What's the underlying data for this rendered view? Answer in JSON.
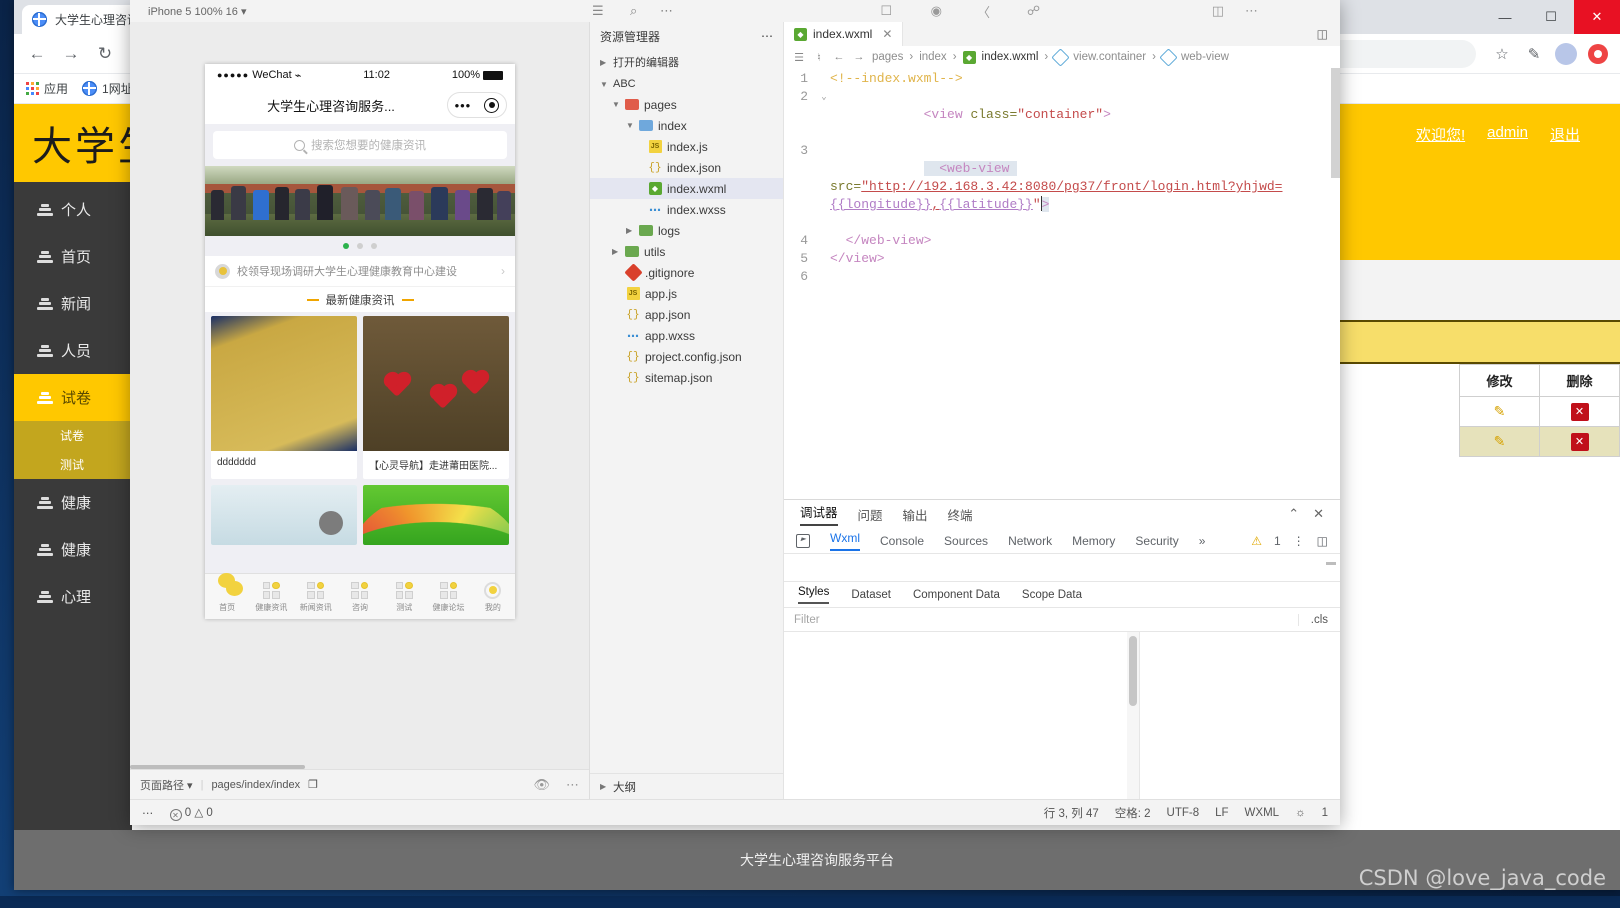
{
  "browser": {
    "tab_title": "大学生心理咨询服务平台",
    "address_value": "",
    "bookmarks": [
      {
        "label": "应用",
        "icon": "apps-grid-icon"
      },
      {
        "label": "1网址",
        "icon": "globe-icon"
      }
    ],
    "window_controls": {
      "minimize": "—",
      "maximize": "☐",
      "close": "✕"
    },
    "nav": {
      "back": "←",
      "forward": "→",
      "reload": "↻",
      "info": "ⓘ"
    },
    "toolbar_icons": [
      "star-icon",
      "extension-icon",
      "profile-avatar-icon",
      "block-icon"
    ]
  },
  "site": {
    "header_title": "大学生",
    "welcome": {
      "greeting": "欢迎您!",
      "user": "admin",
      "logout": "退出"
    },
    "menu": [
      {
        "label": "个人",
        "active": false
      },
      {
        "label": "首页",
        "active": false
      },
      {
        "label": "新闻",
        "active": false
      },
      {
        "label": "人员",
        "active": false
      },
      {
        "label": "试卷",
        "active": true
      },
      {
        "label": "健康",
        "active": false
      },
      {
        "label": "健康",
        "active": false
      },
      {
        "label": "心理",
        "active": false
      }
    ],
    "submenu": [
      {
        "label": "试卷"
      },
      {
        "label": "测试"
      }
    ],
    "table": {
      "headers": [
        "修改",
        "删除"
      ],
      "rows": [
        {
          "edit": "✎",
          "delete": "✕"
        },
        {
          "edit": "✎",
          "delete": "✕"
        }
      ]
    },
    "footer": "大学生心理咨询服务平台"
  },
  "watermark": "CSDN @love_java_code",
  "ide": {
    "top_bar": {
      "device": "iPhone 5 100% 16",
      "icons": [
        "phone-icon",
        "record-icon",
        "sound-icon",
        "share-icon"
      ]
    },
    "simulator": {
      "status": {
        "carrier_dots": "●●●●●",
        "carrier": "WeChat",
        "wifi": "⌁",
        "time": "11:02",
        "battery_pct": "100%"
      },
      "nav_title": "大学生心理咨询服务...",
      "capsule": {
        "dots": "•••",
        "circle": "target-icon"
      },
      "search_placeholder": "搜索您想要的健康资讯",
      "carousel_dots": 3,
      "carousel_active": 0,
      "notice": "校领导现场调研大学生心理健康教育中心建设",
      "section_title": "最新健康资讯",
      "cards": [
        {
          "caption": "ddddddd",
          "thumb": "poster-yellow"
        },
        {
          "caption": "【心灵导航】走进莆田医院...",
          "thumb": "hearts-wood"
        },
        {
          "caption": "",
          "thumb": "pale-blue"
        },
        {
          "caption": "",
          "thumb": "rainbow-green"
        }
      ],
      "tabbar": [
        {
          "label": "首页",
          "icon": "heart-icon",
          "selected": true
        },
        {
          "label": "健康资讯",
          "icon": "grid-icon",
          "selected": false
        },
        {
          "label": "新闻资讯",
          "icon": "grid-icon",
          "selected": false
        },
        {
          "label": "咨询",
          "icon": "grid-icon",
          "selected": false
        },
        {
          "label": "测试",
          "icon": "grid-icon",
          "selected": false
        },
        {
          "label": "健康论坛",
          "icon": "grid-icon",
          "selected": false
        },
        {
          "label": "我的",
          "icon": "gear-icon",
          "selected": false
        }
      ],
      "bottom": {
        "path_label": "页面路径",
        "path_value": "pages/index/index",
        "copy_icon": "copy-icon",
        "eye_icon": "eye-icon",
        "more_icon": "more-icon"
      }
    },
    "explorer": {
      "title": "资源管理器",
      "more": "⋯",
      "open_editors": "打开的编辑器",
      "project": "ABC",
      "tree": [
        {
          "label": "pages",
          "type": "folder",
          "indent": 1,
          "expanded": true,
          "icon": "folder-red-icon"
        },
        {
          "label": "index",
          "type": "folder",
          "indent": 2,
          "expanded": true,
          "icon": "folder-blue-icon"
        },
        {
          "label": "index.js",
          "type": "js",
          "indent": 3,
          "selected": false
        },
        {
          "label": "index.json",
          "type": "json",
          "indent": 3,
          "selected": false
        },
        {
          "label": "index.wxml",
          "type": "wxml",
          "indent": 3,
          "selected": true
        },
        {
          "label": "index.wxss",
          "type": "wxss",
          "indent": 3,
          "selected": false
        },
        {
          "label": "logs",
          "type": "folder",
          "indent": 2,
          "expanded": false,
          "icon": "folder-green-icon"
        },
        {
          "label": "utils",
          "type": "folder",
          "indent": 1,
          "expanded": false,
          "icon": "folder-green-icon"
        },
        {
          "label": ".gitignore",
          "type": "git",
          "indent": 1
        },
        {
          "label": "app.js",
          "type": "js",
          "indent": 1
        },
        {
          "label": "app.json",
          "type": "json",
          "indent": 1
        },
        {
          "label": "app.wxss",
          "type": "wxss",
          "indent": 1
        },
        {
          "label": "project.config.json",
          "type": "json",
          "indent": 1
        },
        {
          "label": "sitemap.json",
          "type": "json",
          "indent": 1
        }
      ],
      "outline": "大纲"
    },
    "editor": {
      "tab": {
        "name": "index.wxml",
        "close": "✕",
        "icon": "wxml-file-icon"
      },
      "split_icon": "split-editor-icon",
      "breadcrumb": [
        "pages",
        "index",
        "index.wxml",
        "view.container",
        "web-view"
      ],
      "lines": [
        {
          "n": 1,
          "fold": "",
          "segments": [
            {
              "t": "<!--index.wxml-->",
              "c": "c-comment"
            }
          ]
        },
        {
          "n": 2,
          "fold": "⌄",
          "segments": [
            {
              "t": "<view ",
              "c": "c-tag"
            },
            {
              "t": "class=",
              "c": "c-attr"
            },
            {
              "t": "\"container\"",
              "c": "c-str"
            },
            {
              "t": ">",
              "c": "c-tag"
            }
          ]
        },
        {
          "n": 3,
          "fold": "",
          "segments": [
            {
              "t": "  <web-view ",
              "c": "c-tag"
            },
            {
              "t": "src=",
              "c": "c-attr"
            },
            {
              "t": "\"http://192.168.3.42:8080/pg37/front/login.html?yhjwd=",
              "c": "c-str"
            },
            {
              "t": "{{longitude}}",
              "c": "c-bind"
            },
            {
              "t": ",",
              "c": "c-str"
            },
            {
              "t": "{{latitude}}",
              "c": "c-bind"
            },
            {
              "t": "\"",
              "c": "c-str"
            },
            {
              "t": ">",
              "c": "c-tag"
            }
          ]
        },
        {
          "n": 4,
          "fold": "",
          "segments": [
            {
              "t": "  </web-view>",
              "c": "c-tag"
            }
          ]
        },
        {
          "n": 5,
          "fold": "",
          "segments": [
            {
              "t": "</view>",
              "c": "c-tag"
            }
          ]
        },
        {
          "n": 6,
          "fold": "",
          "segments": [
            {
              "t": "",
              "c": ""
            }
          ]
        }
      ]
    },
    "devtools": {
      "panels": [
        "调试器",
        "问题",
        "输出",
        "终端"
      ],
      "panels_active": "调试器",
      "collapse_icon": "⌃",
      "close_icon": "✕",
      "tabs": [
        "Wxml",
        "Console",
        "Sources",
        "Network",
        "Memory",
        "Security"
      ],
      "tabs_active": "Wxml",
      "overflow": "»",
      "warning_count": "1",
      "warning_icon": "warning-icon",
      "menu_icon": "⋮",
      "dock_icon": "dock-icon",
      "subtabs": [
        "Styles",
        "Dataset",
        "Component Data",
        "Scope Data"
      ],
      "subtabs_active": "Styles",
      "filter_placeholder": "Filter",
      "cls_label": ".cls"
    },
    "status_bar": {
      "more": "⋯",
      "errors": "0",
      "warnings": "0",
      "position": "行 3, 列 47",
      "indent": "空格: 2",
      "encoding": "UTF-8",
      "eol": "LF",
      "language": "WXML",
      "bell": "🔔",
      "bell_count": "1"
    }
  }
}
